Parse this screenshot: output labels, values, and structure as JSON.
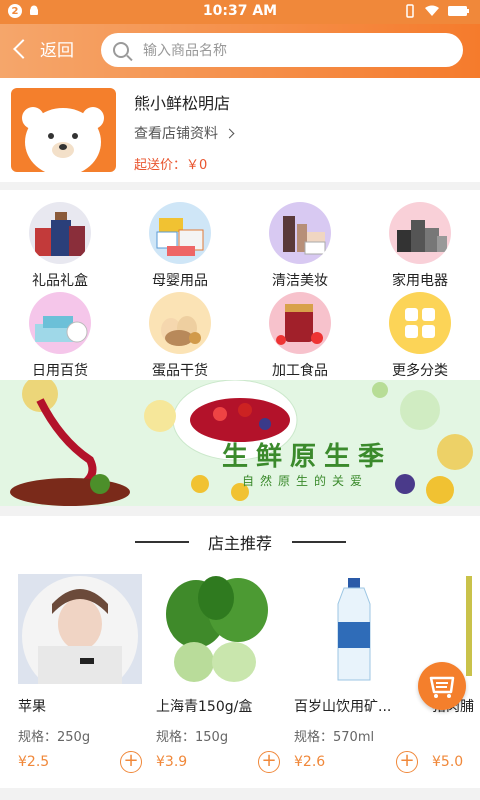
{
  "status_bar": {
    "badge": "2",
    "time": "10:37 AM"
  },
  "header": {
    "back_label": "返回",
    "search_placeholder": "输入商品名称"
  },
  "store": {
    "name": "熊小鲜松明店",
    "info_link": "查看店铺资料",
    "min_delivery": "起送价：￥0"
  },
  "categories": [
    {
      "label": "礼品礼盒",
      "icon": "gift-box-icon",
      "bg": "#e8e8f0"
    },
    {
      "label": "母婴用品",
      "icon": "baby-products-icon",
      "bg": "#cfe6f7"
    },
    {
      "label": "清洁美妆",
      "icon": "cosmetics-icon",
      "bg": "#d8c9f2"
    },
    {
      "label": "家用电器",
      "icon": "appliance-icon",
      "bg": "#f9d0d8"
    },
    {
      "label": "日用百货",
      "icon": "daily-goods-icon",
      "bg": "#f5c6ea"
    },
    {
      "label": "蛋品干货",
      "icon": "eggs-icon",
      "bg": "#fbe3b5"
    },
    {
      "label": "加工食品",
      "icon": "processed-food-icon",
      "bg": "#f7c2cc"
    },
    {
      "label": "更多分类",
      "icon": "more-grid-icon",
      "bg": "#fcd457"
    }
  ],
  "banner": {
    "title": "生鲜原生季",
    "subtitle": "自然原生的关爱"
  },
  "section": {
    "title": "店主推荐"
  },
  "products": [
    {
      "name": "苹果",
      "spec": "规格：250g",
      "price": "¥2.5"
    },
    {
      "name": "上海青150g/盒",
      "spec": "规格：150g",
      "price": "¥3.9"
    },
    {
      "name": "百岁山饮用矿...",
      "spec": "规格：570ml",
      "price": "¥2.6"
    },
    {
      "name": "猪肉脯",
      "spec": "",
      "price": "¥5.0"
    }
  ],
  "colors": {
    "accent": "#f0883a",
    "price": "#f0883a",
    "min_delivery": "#e9552f"
  }
}
